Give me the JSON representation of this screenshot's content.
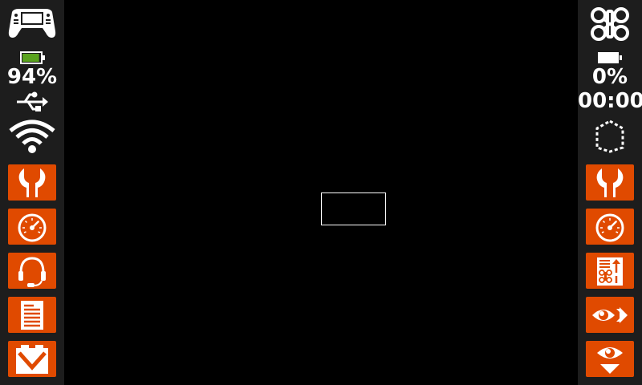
{
  "left": {
    "controller_icon": "controller-icon",
    "battery_percent": "94%",
    "battery_fill": 0.94,
    "usb_icon": "usb-icon",
    "wifi_icon": "wifi-icon",
    "buttons": [
      {
        "name": "wrench-button",
        "icon": "wrench-icon"
      },
      {
        "name": "gauge-button",
        "icon": "gauge-icon"
      },
      {
        "name": "headset-button",
        "icon": "headset-icon"
      },
      {
        "name": "document-button",
        "icon": "document-icon"
      },
      {
        "name": "inbox-button",
        "icon": "inbox-icon"
      }
    ]
  },
  "right": {
    "drone_icon": "drone-icon",
    "battery_percent": "0%",
    "battery_fill": 0,
    "flight_time": "00:00",
    "geofence_icon": "geofence-icon",
    "buttons": [
      {
        "name": "wrench-button",
        "icon": "wrench-icon"
      },
      {
        "name": "gauge-button",
        "icon": "gauge-icon"
      },
      {
        "name": "drone-checklist-button",
        "icon": "drone-checklist-icon"
      },
      {
        "name": "eye-forward-button",
        "icon": "eye-forward-icon"
      },
      {
        "name": "eye-down-button",
        "icon": "eye-down-icon"
      }
    ]
  },
  "colors": {
    "accent": "#e04a00",
    "battery_green": "#5aa31e",
    "sidebar_bg": "#1d1d1d",
    "background": "#000000"
  }
}
